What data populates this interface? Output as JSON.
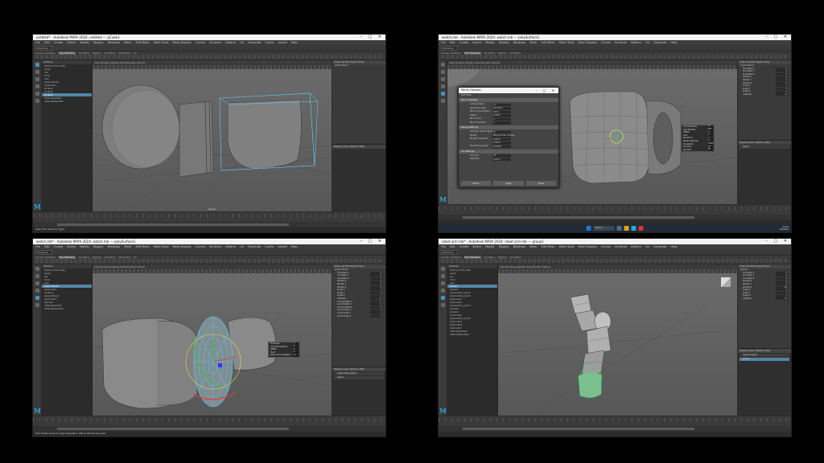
{
  "menus": [
    "File",
    "Edit",
    "Create",
    "Select",
    "Modify",
    "Display",
    "Windows",
    "Mesh",
    "Edit Mesh",
    "Mesh Tools",
    "Mesh Display",
    "Curves",
    "Surfaces",
    "Deform",
    "UV",
    "Generate",
    "Cache",
    "Arnold",
    "Help"
  ],
  "workspace_mode": "Modeling",
  "shelf_tabs": [
    "Curves / Surfaces",
    "Poly Modeling",
    "Sculpting",
    "Rigging",
    "Animation",
    "Rendering",
    "FX",
    "FX Caching",
    "Custom",
    "Arnold",
    "Bifrost",
    "MASH",
    "Motion Graphics",
    "XGen"
  ],
  "outliner_title": "Outliner",
  "outliner_menu": "Display  Show  Help",
  "viewport_menu": "View  Shading  Lighting  Show  Renderer  Panels",
  "camera_label": "persp",
  "channel_header": "Channels  Edit  Object  Show",
  "layers_header": "Display  Layer  Options  Help",
  "windows": [
    {
      "title": "untitled* - Autodesk MAYA 2024: untitled  ---  pCube1",
      "outliner": [
        "persp",
        "top",
        "front",
        "side",
        "polySurface1",
        "pCylinder1",
        "pCube1",
        "pCube2",
        "pCube3",
        "defaultLightSet",
        "defaultObjectSet"
      ],
      "outliner_selected": 8,
      "channels_object": "polySurface1",
      "channels": [],
      "layers": [],
      "cmd": "Select Tool: select an object"
    },
    {
      "title": "watch.mb - Autodesk MAYA 2024: watch.mb  ---  polySurface1",
      "outliner": [],
      "outliner_selected": -1,
      "channels_object": "polySurface1",
      "channels": [
        {
          "n": "Translate X",
          "v": "0"
        },
        {
          "n": "Translate Y",
          "v": "0"
        },
        {
          "n": "Translate Z",
          "v": "0"
        },
        {
          "n": "Rotate X",
          "v": "0"
        },
        {
          "n": "Rotate Y",
          "v": "0"
        },
        {
          "n": "Rotate Z",
          "v": "0"
        },
        {
          "n": "Scale X",
          "v": "1"
        },
        {
          "n": "Scale Y",
          "v": "1"
        },
        {
          "n": "Scale Z",
          "v": "1"
        },
        {
          "n": "Visibility",
          "v": "on"
        }
      ],
      "layers": [
        "layer1"
      ],
      "cmd": "",
      "dialog": {
        "title": "Mirror Options",
        "menu": "Edit  Help",
        "sections": [
          {
            "name": "Mirror Settings",
            "fields": [
              {
                "l": "Cut Geometry",
                "v": "on"
              },
              {
                "l": "Geometry Type",
                "v": "Geometry"
              },
              {
                "l": "Mirror Axis Position",
                "v": "World"
              },
              {
                "l": "Offset",
                "v": "0.0000"
              },
              {
                "l": "Mirror Axis",
                "v": "X"
              },
              {
                "l": "Mirror Direction",
                "v": "+"
              }
            ]
          },
          {
            "name": "Merge Settings",
            "fields": [
              {
                "l": "Combine with Original",
                "v": "on"
              },
              {
                "l": "Merge",
                "v": "Merge border vertices"
              },
              {
                "l": "Merge Threshold",
                "v": "Custom"
              },
              {
                "l": "",
                "v": "0.0010"
              },
              {
                "l": "Smoothing Angle",
                "v": "30.0000"
              }
            ]
          },
          {
            "name": "UV Settings",
            "fields": [
              {
                "l": "Flip UVs",
                "v": "off"
              },
              {
                "l": "Direction",
                "v": "Local U"
              }
            ]
          }
        ],
        "buttons": [
          "Mirror",
          "Apply",
          "Close"
        ]
      },
      "popup": [
        {
          "n": "Cut Geometry",
          "v": "on"
        },
        {
          "n": "Axis Position",
          "v": "Wld"
        },
        {
          "n": "Offset",
          "v": "0"
        },
        {
          "n": "Axis",
          "v": "X"
        },
        {
          "n": "Direction",
          "v": "+"
        },
        {
          "n": "Merge Vertices",
          "v": "on"
        },
        {
          "n": "Threshold",
          "v": "0.001"
        },
        {
          "n": "Flip UVs",
          "v": "off"
        },
        {
          "n": "Smooth",
          "v": "30"
        }
      ]
    },
    {
      "title": "watch.mb* - Autodesk MAYA 2024: watch.mb  ---  polySurface1",
      "outliner": [
        "persp",
        "top",
        "front",
        "side",
        "polySurface1",
        "pCylinder2",
        "pCube4",
        "polySurface2",
        "pCylinder3",
        "pTorus1",
        "defaultLightSet",
        "defaultObjectSet"
      ],
      "outliner_selected": 4,
      "channels_object": "polySurface1",
      "channels": [
        {
          "n": "Translate X",
          "v": "0"
        },
        {
          "n": "Translate Y",
          "v": "0"
        },
        {
          "n": "Translate Z",
          "v": "0"
        },
        {
          "n": "Rotate X",
          "v": "0"
        },
        {
          "n": "Rotate Y",
          "v": "0"
        },
        {
          "n": "Rotate Z",
          "v": "0"
        },
        {
          "n": "Scale X",
          "v": "1"
        },
        {
          "n": "Scale Y",
          "v": "1"
        },
        {
          "n": "Scale Z",
          "v": "1"
        },
        {
          "n": "Visibility",
          "v": "on"
        },
        {
          "n": "Local Rotate X",
          "v": "0"
        },
        {
          "n": "Local Rotate Y",
          "v": "0"
        },
        {
          "n": "Local Rotate Z",
          "v": "0"
        },
        {
          "n": "Local Scale X",
          "v": "1"
        },
        {
          "n": "Local Scale Y",
          "v": "1"
        },
        {
          "n": "Local Scale Z",
          "v": "1"
        }
      ],
      "layers": [
        "polySurface_layer1",
        "layer1"
      ],
      "cmd": "Hold middle mouse to drag manipulator, shift to extrude along axis",
      "popup": [
        {
          "n": "Translate",
          "v": "0"
        },
        {
          "n": "Local Translate Z",
          "v": "0"
        },
        {
          "n": "Offset",
          "v": "0"
        },
        {
          "n": "Pivot",
          "v": "0"
        },
        {
          "n": "Keep Faces Together",
          "v": "on"
        }
      ]
    },
    {
      "title": "robot arm.mb* - Autodesk MAYA 2024: robot arm.mb  ---  group1",
      "outliner": [
        "persp",
        "top",
        "front",
        "side",
        "group1",
        "pCube1",
        "polySurface_joint1",
        "polySurface_joint2",
        "pCylinder1",
        "pCylinder2",
        "polySurface_joint3",
        "pCube2",
        "pCube3",
        "pCylinder4",
        "polySurface_joint4",
        "pCylinder5",
        "pCylinder6",
        "pCylinder7",
        "defaultLightSet",
        "defaultObjectSet"
      ],
      "outliner_selected": 4,
      "channels_object": "group1",
      "channels": [
        {
          "n": "Translate X",
          "v": "0"
        },
        {
          "n": "Translate Y",
          "v": "0"
        },
        {
          "n": "Translate Z",
          "v": "0"
        },
        {
          "n": "Rotate X",
          "v": "0"
        },
        {
          "n": "Rotate Y",
          "v": "0"
        },
        {
          "n": "Rotate Z",
          "v": "-45"
        },
        {
          "n": "Scale X",
          "v": "1"
        },
        {
          "n": "Scale Y",
          "v": "1"
        },
        {
          "n": "Scale Z",
          "v": "1"
        },
        {
          "n": "Visibility",
          "v": "on"
        }
      ],
      "layers": [
        "Layout_layer1",
        "group1"
      ],
      "cmd": ""
    }
  ],
  "taskbar": {
    "search": "Search",
    "time": "10:24",
    "date": "1/3/2024"
  }
}
